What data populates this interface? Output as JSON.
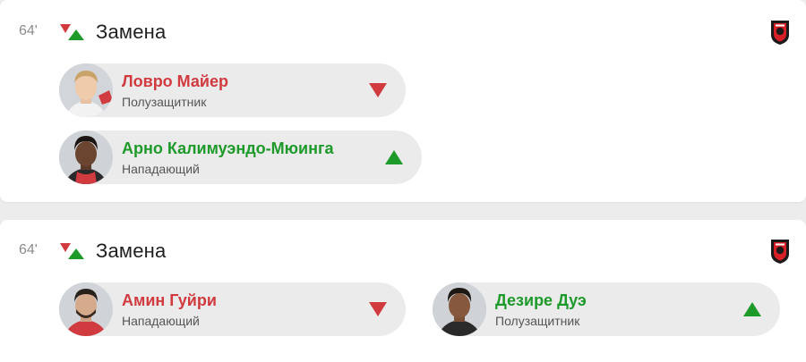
{
  "events": [
    {
      "minute": "64'",
      "title": "Замена",
      "team_crest_icon": "stade-rennais-crest-icon",
      "player_out": {
        "name": "Ловро Майер",
        "position": "Полузащитник",
        "arrow_icon": "arrow-down-red-icon",
        "color": "#d13a3f"
      },
      "player_in": {
        "name": "Арно Калимуэндо-Мюинга",
        "position": "Нападающий",
        "arrow_icon": "arrow-up-green-icon",
        "color": "#1d9a2a"
      }
    },
    {
      "minute": "64'",
      "title": "Замена",
      "team_crest_icon": "stade-rennais-crest-icon",
      "player_out": {
        "name": "Амин Гуйри",
        "position": "Нападающий",
        "arrow_icon": "arrow-down-red-icon",
        "color": "#d13a3f"
      },
      "player_in": {
        "name": "Дезире Дуэ",
        "position": "Полузащитник",
        "arrow_icon": "arrow-up-green-icon",
        "color": "#1d9a2a"
      }
    }
  ]
}
